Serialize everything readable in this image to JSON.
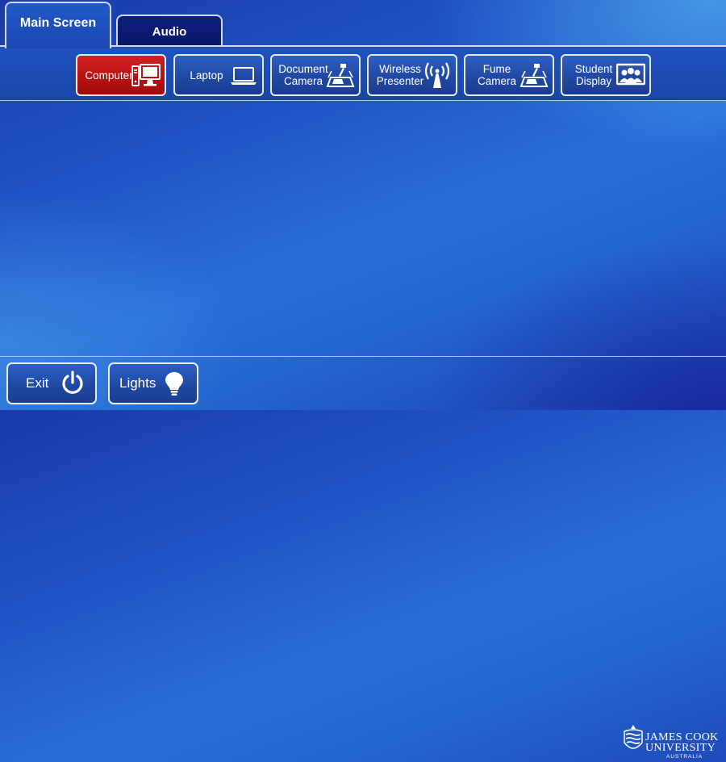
{
  "tabs": [
    {
      "label": "Main Screen",
      "active": true
    },
    {
      "label": "Audio",
      "active": false
    }
  ],
  "sources": [
    {
      "label": "Computer",
      "icon": "computer-icon",
      "active": true
    },
    {
      "label": "Laptop",
      "icon": "laptop-icon",
      "active": false
    },
    {
      "label": "Document Camera",
      "icon": "document-camera-icon",
      "active": false
    },
    {
      "label": "Wireless Presenter",
      "icon": "wireless-presenter-icon",
      "active": false
    },
    {
      "label": "Fume Camera",
      "icon": "fume-camera-icon",
      "active": false
    },
    {
      "label": "Student Display",
      "icon": "student-display-icon",
      "active": false
    }
  ],
  "bottom": {
    "exit_label": "Exit",
    "exit_icon": "power-icon",
    "lights_label": "Lights",
    "lights_icon": "lightbulb-icon"
  },
  "logo": {
    "line1": "JAMES COOK",
    "line2": "UNIVERSITY",
    "line3": "AUSTRALIA"
  },
  "colors": {
    "background": "#1f52c4",
    "active_source": "#c21414",
    "button_border": "#e6ecf8"
  }
}
